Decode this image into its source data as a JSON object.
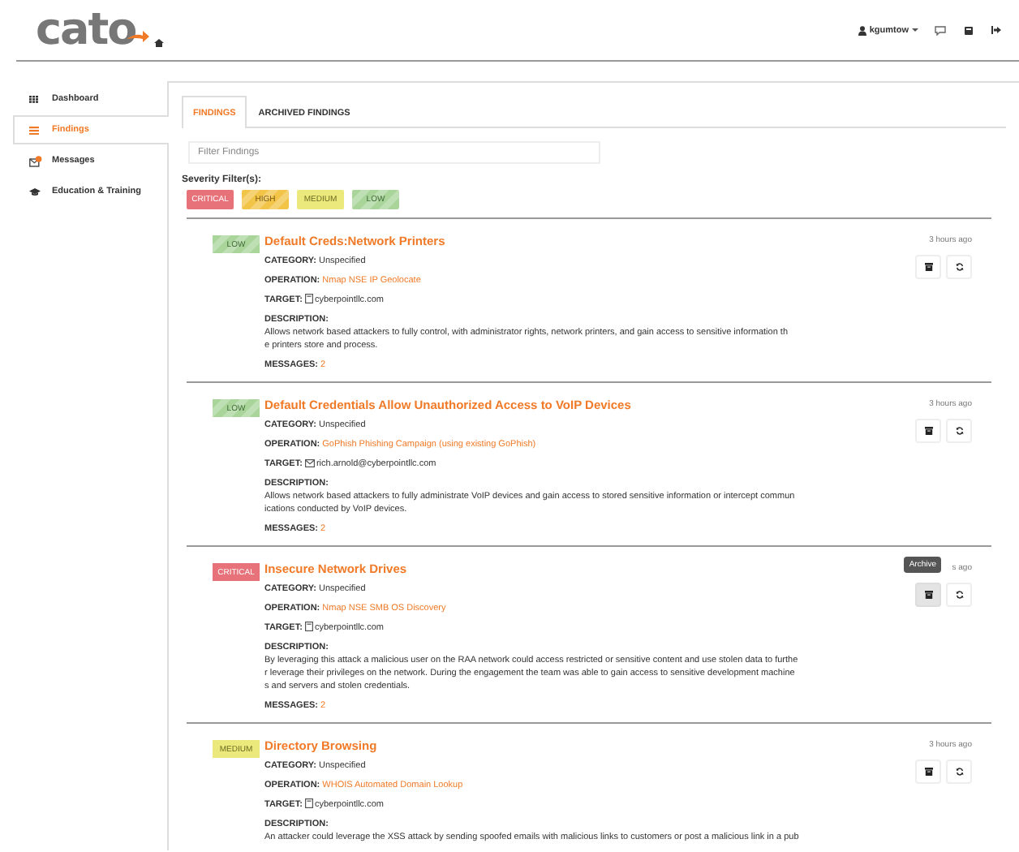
{
  "header": {
    "logo": "cato",
    "user": "kgumtow"
  },
  "sidebar": {
    "items": [
      {
        "label": "Dashboard",
        "kind": "grid",
        "selected": false
      },
      {
        "label": "Findings",
        "kind": "list",
        "selected": true
      },
      {
        "label": "Messages",
        "kind": "messages",
        "selected": false
      },
      {
        "label": "Education & Training",
        "kind": "cap",
        "selected": false
      }
    ]
  },
  "tabs": [
    {
      "label": "FINDINGS",
      "selected": true
    },
    {
      "label": "ARCHIVED FINDINGS",
      "selected": false
    }
  ],
  "filter": {
    "placeholder": "Filter Findings"
  },
  "severity_filter": {
    "label": "Severity Filter(s):",
    "chips": [
      {
        "label": "CRITICAL",
        "kind": "critical"
      },
      {
        "label": "HIGH",
        "kind": "high"
      },
      {
        "label": "MEDIUM",
        "kind": "medium"
      },
      {
        "label": "LOW",
        "kind": "low"
      }
    ]
  },
  "findings": [
    {
      "badge": {
        "kind": "low",
        "label": "LOW"
      },
      "title": "Default Creds:Network Printers",
      "time": "3 hours ago",
      "category_label": "CATEGORY:",
      "category": "Unspecified",
      "operation_label": "OPERATION:",
      "operation": "Nmap NSE IP Geolocate",
      "target_label": "TARGET:",
      "target": {
        "kind": "host",
        "text": "cyberpointllc.com"
      },
      "description_label": "DESCRIPTION:",
      "description_lines": [
        "Allows network based attackers to fully control, with administrator rights, network printers, and gain access to sensitive information th",
        "e printers store and process."
      ],
      "messages_label": "MESSAGES:",
      "messages": "2",
      "archive_hovered": false
    },
    {
      "badge": {
        "kind": "low",
        "label": "LOW"
      },
      "title": "Default Credentials Allow Unauthorized Access to VoIP Devices",
      "time": "3 hours ago",
      "category_label": "CATEGORY:",
      "category": "Unspecified",
      "operation_label": "OPERATION:",
      "operation": "GoPhish Phishing Campaign (using existing GoPhish)",
      "target_label": "TARGET:",
      "target": {
        "kind": "email",
        "text": "rich.arnold@cyberpointllc.com"
      },
      "description_label": "DESCRIPTION:",
      "description_lines": [
        "Allows network based attackers to fully administrate VoIP devices and gain access to stored sensitive information or intercept commun",
        "ications conducted by VoIP devices."
      ],
      "messages_label": "MESSAGES:",
      "messages": "2",
      "archive_hovered": false
    },
    {
      "badge": {
        "kind": "critical",
        "label": "CRITICAL"
      },
      "title": "Insecure Network Drives",
      "time": "s ago",
      "category_label": "CATEGORY:",
      "category": "Unspecified",
      "operation_label": "OPERATION:",
      "operation": "Nmap NSE SMB OS Discovery",
      "target_label": "TARGET:",
      "target": {
        "kind": "host",
        "text": "cyberpointllc.com"
      },
      "description_label": "DESCRIPTION:",
      "description_lines": [
        "By leveraging this attack a malicious user on the RAA network could access restricted or sensitive content and use stolen data to furthe",
        "r leverage their privileges on the network. During the engagement the team was able to gain access to sensitive development machine",
        "s and servers and stolen credentials."
      ],
      "messages_label": "MESSAGES:",
      "messages": "2",
      "archive_hovered": true,
      "tooltip": "Archive"
    },
    {
      "badge": {
        "kind": "medium",
        "label": "MEDIUM"
      },
      "title": "Directory Browsing",
      "time": "3 hours ago",
      "category_label": "CATEGORY:",
      "category": "Unspecified",
      "operation_label": "OPERATION:",
      "operation": "WHOIS Automated Domain Lookup",
      "target_label": "TARGET:",
      "target": {
        "kind": "host",
        "text": "cyberpointllc.com"
      },
      "description_label": "DESCRIPTION:",
      "description_lines": [
        "An attacker could leverage the XSS attack by sending spoofed emails with malicious links to customers or post a malicious link in a pub"
      ],
      "archive_hovered": false
    }
  ]
}
